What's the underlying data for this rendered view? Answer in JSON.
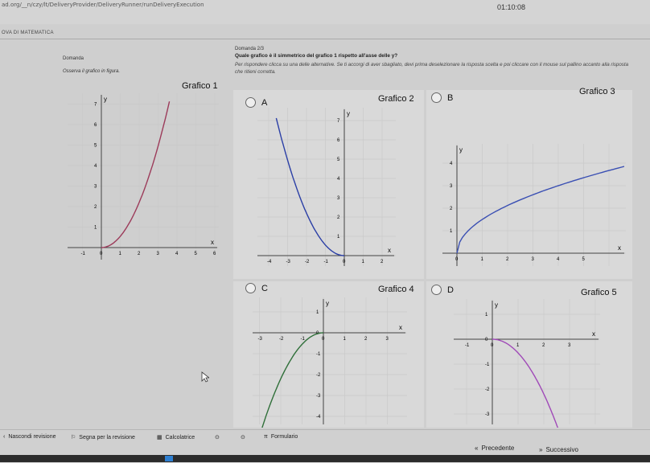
{
  "browser": {
    "url": "ad.org/__n/czy/lt/DeliveryProvider/DeliveryRunner/runDeliveryExecution"
  },
  "timer": "01:10:08",
  "brand": "OVA DI MATEMATICA",
  "left_pane": {
    "section": "Domanda",
    "instruction": "Osserva il grafico in figura."
  },
  "question": {
    "counter": "Domanda 2/3",
    "text": "Quale grafico è il simmetrico del grafico 1 rispetto all'asse delle y?",
    "instructions": "Per rispondere clicca su una delle alternative. Se ti accorgi di aver sbagliato, devi prima deselezionare la risposta scelta e poi cliccare con il mouse sul pallino accanto alla risposta che ritieni corretta."
  },
  "figure": {
    "title": "Grafico 1"
  },
  "options": [
    {
      "letter": "A",
      "graph_title": "Grafico 2"
    },
    {
      "letter": "B",
      "graph_title": "Grafico 3"
    },
    {
      "letter": "C",
      "graph_title": "Grafico 4"
    },
    {
      "letter": "D",
      "graph_title": "Grafico 5"
    }
  ],
  "axis": {
    "x": "x",
    "y": "y"
  },
  "graphs": {
    "g1": {
      "xt": [
        "-1",
        "0",
        "1",
        "2",
        "3",
        "4",
        "5",
        "6"
      ],
      "yt": [
        "1",
        "2",
        "3",
        "4",
        "5",
        "6",
        "7"
      ]
    },
    "g2": {
      "xt": [
        "-4",
        "-3",
        "-2",
        "-1",
        "0",
        "1",
        "2"
      ],
      "yt": [
        "1",
        "2",
        "3",
        "4",
        "5",
        "6",
        "7"
      ]
    },
    "g3": {
      "xt": [
        "0",
        "1",
        "2",
        "3",
        "4",
        "5"
      ],
      "yt": [
        "1",
        "2",
        "3",
        "4"
      ]
    },
    "g4": {
      "xt": [
        "-3",
        "-2",
        "-1",
        "0",
        "1",
        "2",
        "3"
      ],
      "yt": [
        "1",
        "0",
        "-1",
        "-2",
        "-3",
        "-4"
      ]
    },
    "g5": {
      "xt": [
        "-1",
        "0",
        "1",
        "2",
        "3"
      ],
      "yt": [
        "1",
        "0",
        "-1",
        "-2",
        "-3"
      ]
    }
  },
  "footer": {
    "hide_review": "Nascondi revisione",
    "mark_review": "Segna per la revisione",
    "calculator": "Calcolatrice",
    "formulario": "Formulario",
    "prev": "Precedente",
    "next": "Successivo"
  },
  "colors": {
    "curve": "#9c3b5a",
    "option_d_curve": "#a04ab8",
    "grid": "#c9c9c9",
    "accent": "#6b6b6b"
  }
}
